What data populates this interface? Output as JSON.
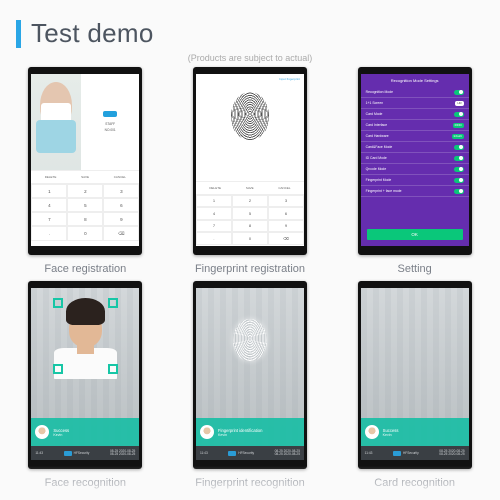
{
  "header": {
    "title": "Test demo"
  },
  "subtitle": "(Products are subject to actual)",
  "screens": [
    {
      "caption": "Face registration"
    },
    {
      "caption": "Fingerprint registration"
    },
    {
      "caption": "Setting"
    },
    {
      "caption": "Face recognition"
    },
    {
      "caption": "Fingerprint recognition"
    },
    {
      "caption": "Card recognition"
    }
  ],
  "s1": {
    "info_label": "STAFF",
    "info_id": "NO.001",
    "btn_delete": "DELETE",
    "btn_save": "SAVE",
    "btn_cancel": "CANCEL",
    "keys": [
      "1",
      "2",
      "3",
      "4",
      "5",
      "6",
      "7",
      "8",
      "9",
      ".",
      "0",
      "⌫"
    ]
  },
  "s2": {
    "header": "Input fingerprint",
    "btn_delete": "DELETE",
    "btn_save": "SAVE",
    "btn_cancel": "CANCEL",
    "keys": [
      "1",
      "2",
      "3",
      "4",
      "5",
      "6",
      "7",
      "8",
      "9",
      ".",
      "0",
      "⌫"
    ]
  },
  "s3": {
    "title": "Recognition Mode Settings",
    "rows": [
      {
        "label": "Recognition Mode",
        "kind": "toggle"
      },
      {
        "label": "1+1 Screen",
        "kind": "chip",
        "value": "HR"
      },
      {
        "label": "Card Mode",
        "kind": "toggle"
      },
      {
        "label": "Card Interface",
        "kind": "chip_on",
        "value": "RFID"
      },
      {
        "label": "Card Hardware",
        "kind": "chip_on",
        "value": "Inbuilt"
      },
      {
        "label": "Card&Face Mode",
        "kind": "toggle"
      },
      {
        "label": "ID Card Mode",
        "kind": "toggle"
      },
      {
        "label": "Qrcode Mode",
        "kind": "toggle"
      },
      {
        "label": "Fingerprint Mode",
        "kind": "toggle"
      },
      {
        "label": "Fingerprint + face mode",
        "kind": "toggle"
      }
    ],
    "ok": "OK"
  },
  "recognition": {
    "status": "Success",
    "name": "Kevin",
    "fp_title": "Fingerprint identification",
    "time": "11:43",
    "brand": "HFSecurity",
    "date1": "08-25   2020-08-25",
    "date2": "08-25   2020-08-25"
  }
}
